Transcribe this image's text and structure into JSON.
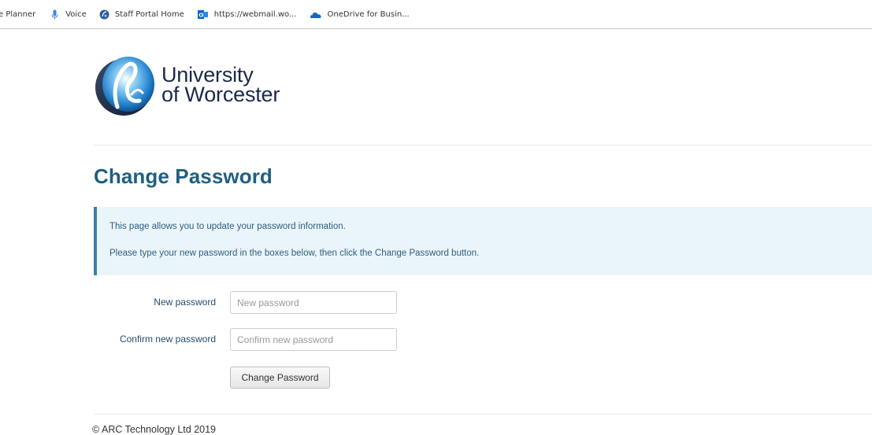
{
  "bookmarks": [
    {
      "label": "e Planner",
      "icon": "none"
    },
    {
      "label": "Voice",
      "icon": "microphone-icon"
    },
    {
      "label": "Staff Portal Home",
      "icon": "portal-globe-icon"
    },
    {
      "label": "https://webmail.wo...",
      "icon": "outlook-icon"
    },
    {
      "label": "OneDrive for Busin...",
      "icon": "onedrive-cloud-icon"
    }
  ],
  "logo": {
    "line1": "University",
    "line2": "of Worcester"
  },
  "page_title": "Change Password",
  "info": {
    "line1": "This page allows you to update your password information.",
    "line2": "Please type your new password in the boxes below, then click the Change Password button."
  },
  "form": {
    "new_password_label": "New password",
    "new_password_placeholder": "New password",
    "new_password_value": "",
    "confirm_password_label": "Confirm new password",
    "confirm_password_placeholder": "Confirm new password",
    "confirm_password_value": "",
    "submit_label": "Change Password"
  },
  "footer": "© ARC Technology Ltd 2019",
  "colors": {
    "title": "#1f5f82",
    "info_bg": "#eaf5fa",
    "info_border": "#3d7fa6",
    "label": "#234d6b"
  }
}
